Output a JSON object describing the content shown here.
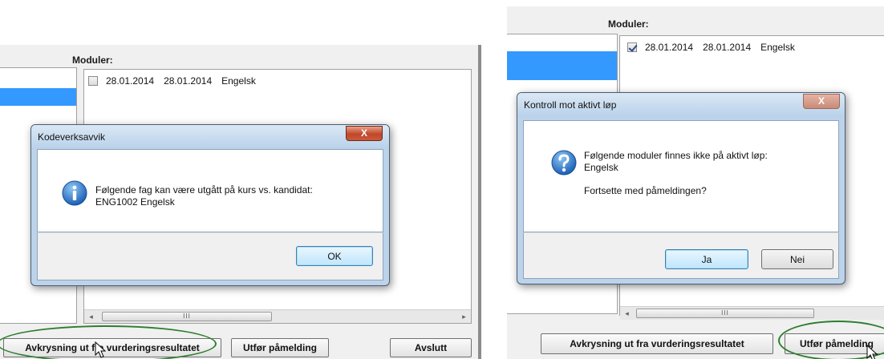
{
  "left": {
    "modules_label": "Moduler:",
    "modules": [
      {
        "checked": false,
        "date_from": "28.01.2014",
        "date_to": "28.01.2014",
        "name": "Engelsk"
      }
    ],
    "scroll_thumb": "III",
    "buttons": {
      "avkrysning": "Avkrysning ut fra vurderingsresultatet",
      "utfor": "Utfør påmelding",
      "avslutt": "Avslutt"
    },
    "dialog": {
      "title": "Kodeverksavvik",
      "close": "X",
      "message_line1": "Følgende fag kan være utgått på kurs vs. kandidat:",
      "message_line2": "ENG1002 Engelsk",
      "ok": "OK",
      "icon": "info-icon"
    }
  },
  "right": {
    "modules_label": "Moduler:",
    "modules": [
      {
        "checked": true,
        "date_from": "28.01.2014",
        "date_to": "28.01.2014",
        "name": "Engelsk"
      }
    ],
    "scroll_thumb": "III",
    "buttons": {
      "avkrysning": "Avkrysning ut fra vurderingsresultatet",
      "utfor": "Utfør påmelding"
    },
    "dialog": {
      "title": "Kontroll mot aktivt løp",
      "close": "X",
      "message_line1": "Følgende moduler finnes ikke på aktivt løp:",
      "message_line2": "Engelsk",
      "question": "Fortsette med påmeldingen?",
      "yes": "Ja",
      "no": "Nei",
      "icon": "question-icon"
    }
  },
  "colors": {
    "selection": "#3399ff",
    "highlight_oval": "#2e7d2e"
  }
}
